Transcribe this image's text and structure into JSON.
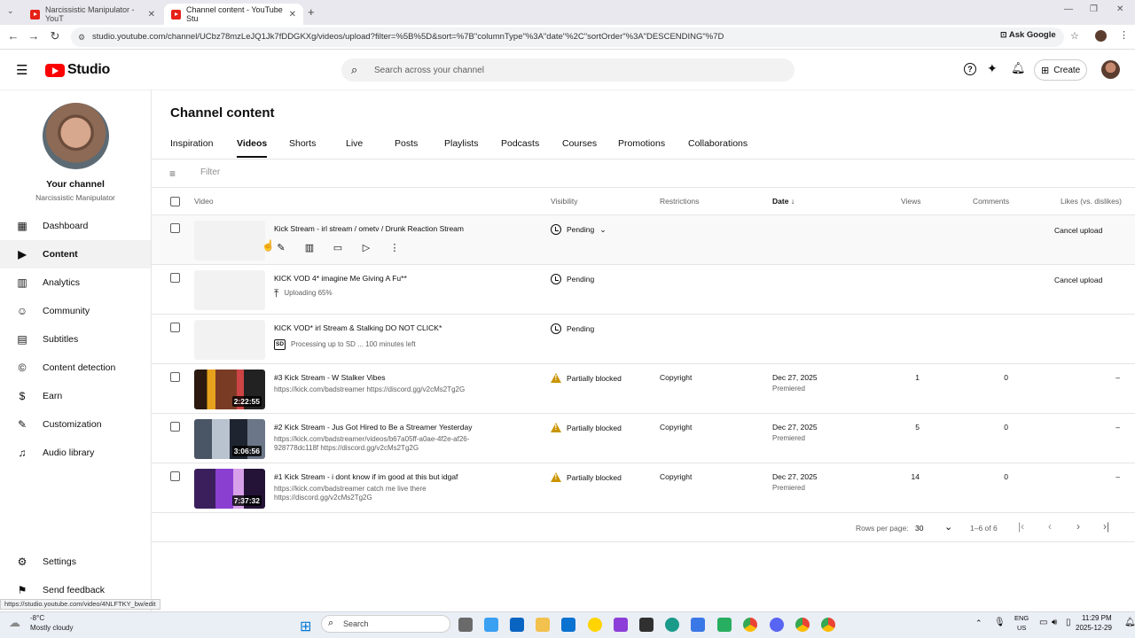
{
  "browser": {
    "tabs": [
      {
        "title": "Narcissistic Manipulator - YouT",
        "active": false
      },
      {
        "title": "Channel content - YouTube Stu",
        "active": true
      }
    ],
    "url": "studio.youtube.com/channel/UCbz78mzLeJQ1Jk7fDDGKXg/videos/upload?filter=%5B%5D&sort=%7B\"columnType\"%3A\"date\"%2C\"sortOrder\"%3A\"DESCENDING\"%7D",
    "ask_google": "Ask Google",
    "status_url": "https://studio.youtube.com/video/4NLFTKY_bw/edit"
  },
  "header": {
    "logo_text": "Studio",
    "search_placeholder": "Search across your channel",
    "create_label": "Create"
  },
  "sidebar": {
    "channel_title": "Your channel",
    "channel_name": "Narcissistic Manipulator",
    "items": [
      {
        "label": "Dashboard",
        "icon": "dashboard-icon",
        "active": false
      },
      {
        "label": "Content",
        "icon": "content-icon",
        "active": true
      },
      {
        "label": "Analytics",
        "icon": "analytics-icon",
        "active": false
      },
      {
        "label": "Community",
        "icon": "community-icon",
        "active": false
      },
      {
        "label": "Subtitles",
        "icon": "subtitles-icon",
        "active": false
      },
      {
        "label": "Content detection",
        "icon": "content-detection-icon",
        "active": false
      },
      {
        "label": "Earn",
        "icon": "earn-icon",
        "active": false
      },
      {
        "label": "Customization",
        "icon": "customization-icon",
        "active": false
      },
      {
        "label": "Audio library",
        "icon": "audio-library-icon",
        "active": false
      }
    ],
    "settings_label": "Settings",
    "feedback_label": "Send feedback"
  },
  "main": {
    "title": "Channel content",
    "tabs": [
      "Inspiration",
      "Videos",
      "Shorts",
      "Live",
      "Posts",
      "Playlists",
      "Podcasts",
      "Courses",
      "Promotions",
      "Collaborations"
    ],
    "active_tab": "Videos",
    "filter_placeholder": "Filter",
    "columns": {
      "video": "Video",
      "visibility": "Visibility",
      "restrictions": "Restrictions",
      "date": "Date",
      "views": "Views",
      "comments": "Comments",
      "likes": "Likes (vs. dislikes)"
    },
    "rows": [
      {
        "title": "Kick Stream - irl stream / ometv / Drunk Reaction Stream",
        "desc": "",
        "visibility": "Pending",
        "action": "Cancel upload"
      },
      {
        "title": "KICK VOD 4* imagine Me Giving A Fu**",
        "desc": "Uploading 65%",
        "visibility": "Pending",
        "action": "Cancel upload"
      },
      {
        "title": "KICK VOD* irl Stream & Stalking DO NOT CLICK*",
        "desc": "Processing up to SD ... 100 minutes left",
        "visibility": "Pending",
        "action": ""
      },
      {
        "title": "#3 Kick Stream - W Stalker Vibes",
        "desc": "https://kick.com/badstreamer https://discord.gg/v2cMs2Tg2G",
        "duration": "2:22:55",
        "visibility": "Partially blocked",
        "restrictions": "Copyright",
        "date": "Dec 27, 2025",
        "date_sub": "Premiered",
        "views": "1",
        "comments": "0",
        "likes": "–"
      },
      {
        "title": "#2 Kick Stream - Jus Got Hired to Be a Streamer Yesterday",
        "desc": "https://kick.com/badstreamer/videos/b67a05ff-a0ae-4f2e-af26-928778dc118f https://discord.gg/v2cMs2Tg2G",
        "duration": "3:06:56",
        "visibility": "Partially blocked",
        "restrictions": "Copyright",
        "date": "Dec 27, 2025",
        "date_sub": "Premiered",
        "views": "5",
        "comments": "0",
        "likes": "–"
      },
      {
        "title": "#1 Kick Stream - i dont know if im good at this but idgaf",
        "desc": "https://kick.com/badstreamer catch me live there https://discord.gg/v2cMs2Tg2G",
        "duration": "7:37:32",
        "visibility": "Partially blocked",
        "restrictions": "Copyright",
        "date": "Dec 27, 2025",
        "date_sub": "Premiered",
        "views": "14",
        "comments": "0",
        "likes": "–"
      }
    ],
    "pagination": {
      "rows_label": "Rows per page:",
      "rows_value": "30",
      "range": "1–6 of 6"
    }
  },
  "taskbar": {
    "weather_temp": "-8°C",
    "weather_desc": "Mostly cloudy",
    "search_placeholder": "Search",
    "lang": "ENG",
    "region": "US",
    "time": "11:29 PM",
    "date": "2025-12-29"
  },
  "colors": {
    "accent_red": "#ff0000",
    "warning": "#c99400"
  }
}
